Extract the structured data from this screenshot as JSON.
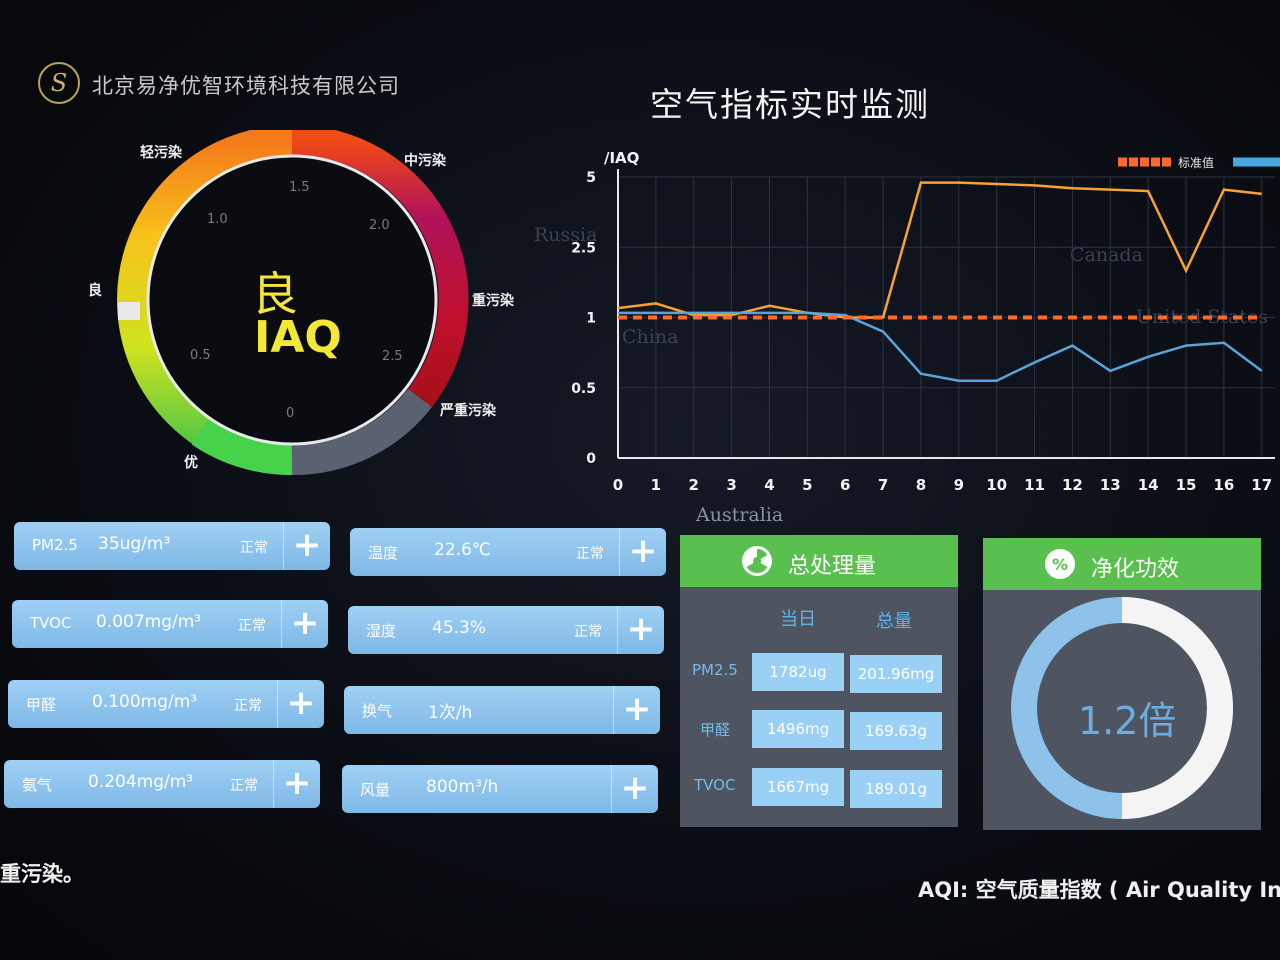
{
  "header": {
    "company": "北京易净优智环境科技有限公司",
    "title": "空气指标实时监测"
  },
  "gauge": {
    "main_text": "良",
    "unit_text": "IAQ",
    "labels": {
      "you": "优",
      "liang": "良",
      "qing": "轻污染",
      "zhong": "中污染",
      "zhong2": "重污染",
      "yanzhong": "严重污染"
    },
    "ticks": [
      "0",
      "0.5",
      "1.0",
      "1.5",
      "2.0",
      "2.5"
    ]
  },
  "chart_data": {
    "type": "line",
    "ylabel": "/IAQ",
    "y_ticks": [
      "0",
      "0.5",
      "1",
      "2.5",
      "5"
    ],
    "x": [
      0,
      1,
      2,
      3,
      4,
      5,
      6,
      7,
      8,
      9,
      10,
      11,
      12,
      13,
      14,
      15,
      16,
      17
    ],
    "legend": [
      "标准值"
    ],
    "series": [
      {
        "name": "",
        "color": "#f7a233",
        "values": [
          1.2,
          1.3,
          1.05,
          1.05,
          1.25,
          1.1,
          1.0,
          1.0,
          4.8,
          4.8,
          4.75,
          4.7,
          4.6,
          4.55,
          4.5,
          2.0,
          4.55,
          4.4
        ]
      },
      {
        "name": "",
        "color": "#5aa4da",
        "values": [
          1.1,
          1.1,
          1.1,
          1.1,
          1.1,
          1.1,
          1.05,
          0.9,
          0.6,
          0.55,
          0.55,
          0.68,
          0.8,
          0.62,
          0.72,
          0.8,
          0.82,
          0.62
        ]
      },
      {
        "name": "标准值",
        "color": "#ff6a2a",
        "values": [
          1,
          1,
          1,
          1,
          1,
          1,
          1,
          1,
          1,
          1,
          1,
          1,
          1,
          1,
          1,
          1,
          1,
          1
        ]
      }
    ],
    "map_labels": [
      "Russia",
      "China",
      "Canada",
      "United  States",
      "Australia"
    ]
  },
  "metrics": [
    {
      "name": "PM2.5",
      "value": "35ug/m³",
      "status": "正常"
    },
    {
      "name": "TVOC",
      "value": "0.007mg/m³",
      "status": "正常"
    },
    {
      "name": "甲醛",
      "value": "0.100mg/m³",
      "status": "正常"
    },
    {
      "name": "氨气",
      "value": "0.204mg/m³",
      "status": "正常"
    },
    {
      "name": "温度",
      "value": "22.6℃",
      "status": "正常"
    },
    {
      "name": "湿度",
      "value": "45.3%",
      "status": "正常"
    },
    {
      "name": "换气",
      "value": "1次/h",
      "status": ""
    },
    {
      "name": "风量",
      "value": "800m³/h",
      "status": ""
    }
  ],
  "plus_label": "+",
  "total": {
    "title": "总处理量",
    "col_day": "当日",
    "col_total": "总量",
    "rows": [
      {
        "label": "PM2.5",
        "day": "1782ug",
        "total": "201.96mg"
      },
      {
        "label": "甲醛",
        "day": "1496mg",
        "total": "169.63g"
      },
      {
        "label": "TVOC",
        "day": "1667mg",
        "total": "189.01g"
      }
    ]
  },
  "efficiency": {
    "title": "净化功效",
    "value": "1.2倍",
    "ring_fraction": 0.5
  },
  "footer": {
    "left": "重污染。",
    "right": "AQI: 空气质量指数 ( Air Quality Index"
  }
}
